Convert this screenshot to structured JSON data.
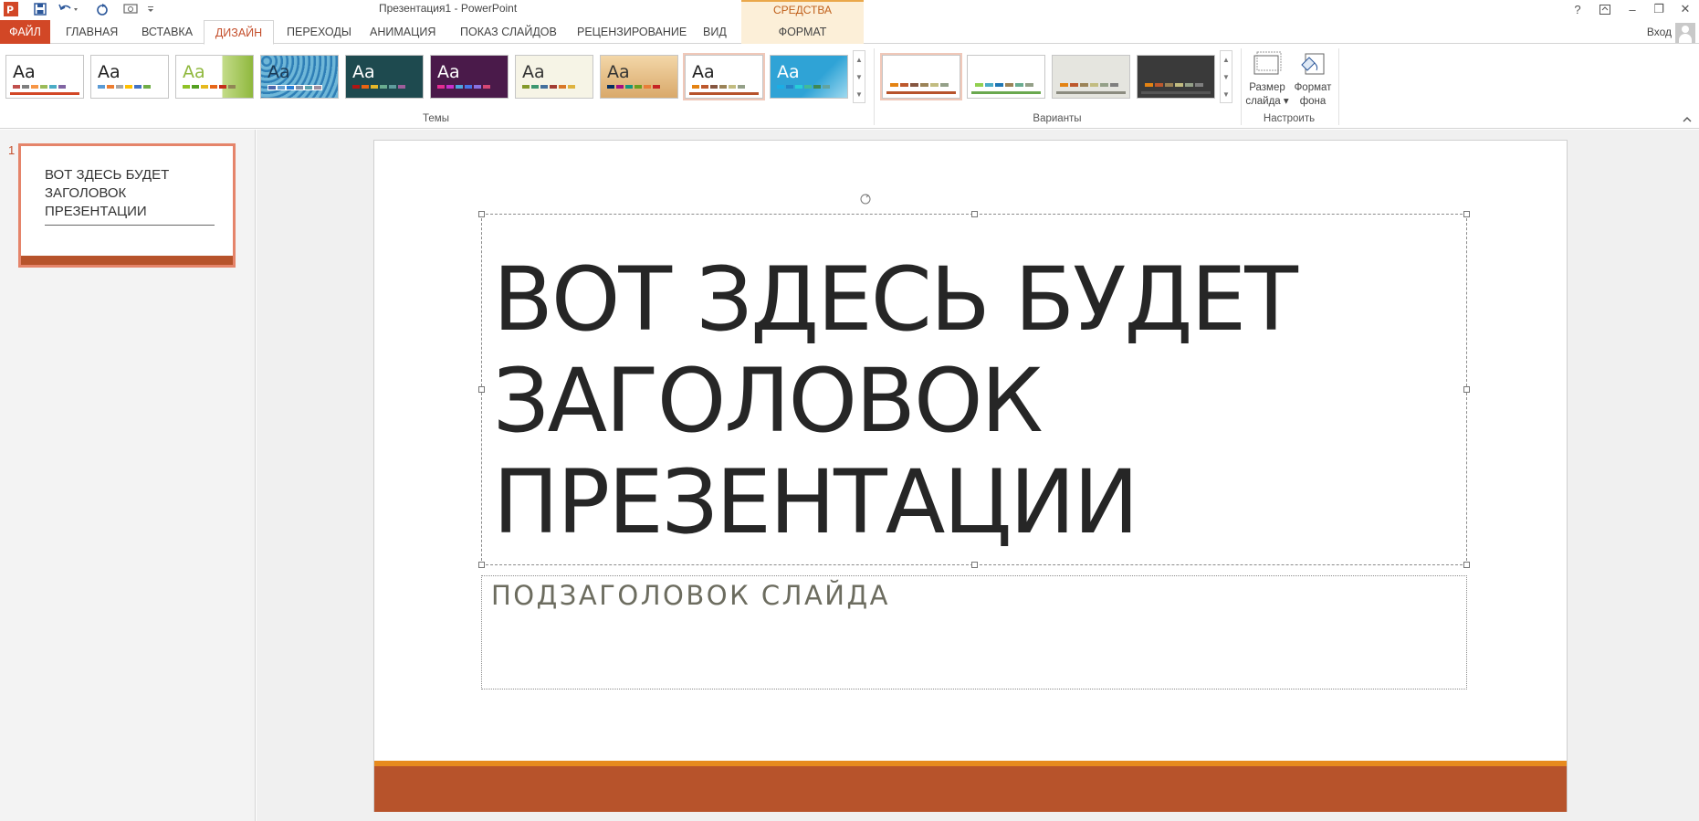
{
  "window": {
    "title": "Презентация1 - PowerPoint",
    "context_header": "СРЕДСТВА РИСОВАНИЯ",
    "help": "?",
    "minimize": "–",
    "restore": "❐",
    "close": "✕"
  },
  "tabs": [
    {
      "id": "file",
      "label": "ФАЙЛ"
    },
    {
      "id": "home",
      "label": "ГЛАВНАЯ"
    },
    {
      "id": "insert",
      "label": "ВСТАВКА"
    },
    {
      "id": "design",
      "label": "ДИЗАЙН",
      "active": true
    },
    {
      "id": "transitions",
      "label": "ПЕРЕХОДЫ"
    },
    {
      "id": "animation",
      "label": "АНИМАЦИЯ"
    },
    {
      "id": "slideshow",
      "label": "ПОКАЗ СЛАЙДОВ"
    },
    {
      "id": "review",
      "label": "РЕЦЕНЗИРОВАНИЕ"
    },
    {
      "id": "view",
      "label": "ВИД"
    },
    {
      "id": "format",
      "label": "ФОРМАТ"
    }
  ],
  "signin": "Вход",
  "ribbon": {
    "groups": {
      "themes": "Темы",
      "variants": "Варианты",
      "customize": "Настроить"
    },
    "theme_sample": "Aa",
    "slide_size": {
      "line1": "Размер",
      "line2": "слайда ▾"
    },
    "format_background": {
      "line1": "Формат",
      "line2": "фона"
    },
    "scroll": {
      "up": "▲",
      "down": "▼",
      "more": "▼"
    }
  },
  "colors": {
    "accent": "#d24726",
    "slide_band": "#b7532b",
    "slide_band_thin": "#e78a1e",
    "context_header_bg": "#fcefd8"
  },
  "thumbnail": {
    "number": "1",
    "title": "ВОТ ЗДЕСЬ БУДЕТ ЗАГОЛОВОК ПРЕЗЕНТАЦИИ"
  },
  "slide": {
    "title_lines": [
      "ВОТ ЗДЕСЬ БУДЕТ",
      "ЗАГОЛОВОК",
      "ПРЕЗЕНТАЦИИ"
    ],
    "subtitle": "ПОДЗАГОЛОВОК СЛАЙДА"
  }
}
